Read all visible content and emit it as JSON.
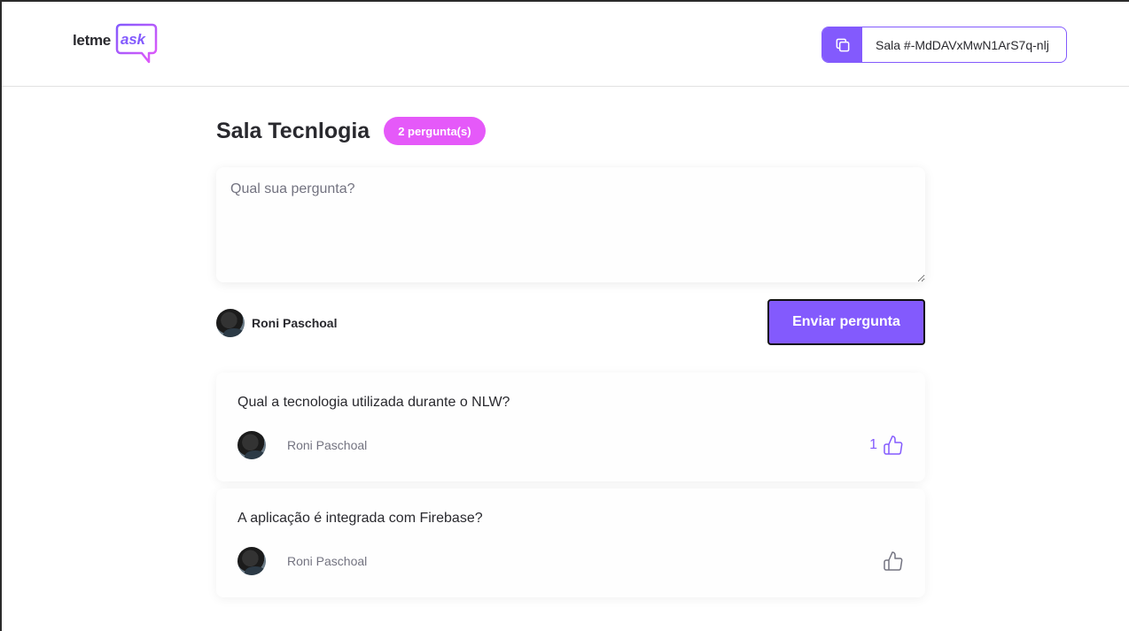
{
  "header": {
    "logo_prefix": "letme",
    "logo_accent": "ask",
    "room_code_label": "Sala #-MdDAVxMwN1ArS7q-nlj"
  },
  "room": {
    "title": "Sala Tecnlogia",
    "question_count": "2 pergunta(s)"
  },
  "form": {
    "placeholder": "Qual sua pergunta?",
    "user_name": "Roni Paschoal",
    "submit_label": "Enviar pergunta"
  },
  "questions": [
    {
      "content": "Qual a tecnologia utilizada durante o NLW?",
      "author": "Roni Paschoal",
      "likes": "1",
      "liked": true
    },
    {
      "content": "A aplicação é integrada com Firebase?",
      "author": "Roni Paschoal",
      "likes": "",
      "liked": false
    }
  ],
  "colors": {
    "accent": "#835afd",
    "badge": "#e559f9",
    "text": "#29292e",
    "muted": "#737380"
  },
  "icons": [
    "copy-icon",
    "like-icon",
    "logo-bubble-icon"
  ]
}
